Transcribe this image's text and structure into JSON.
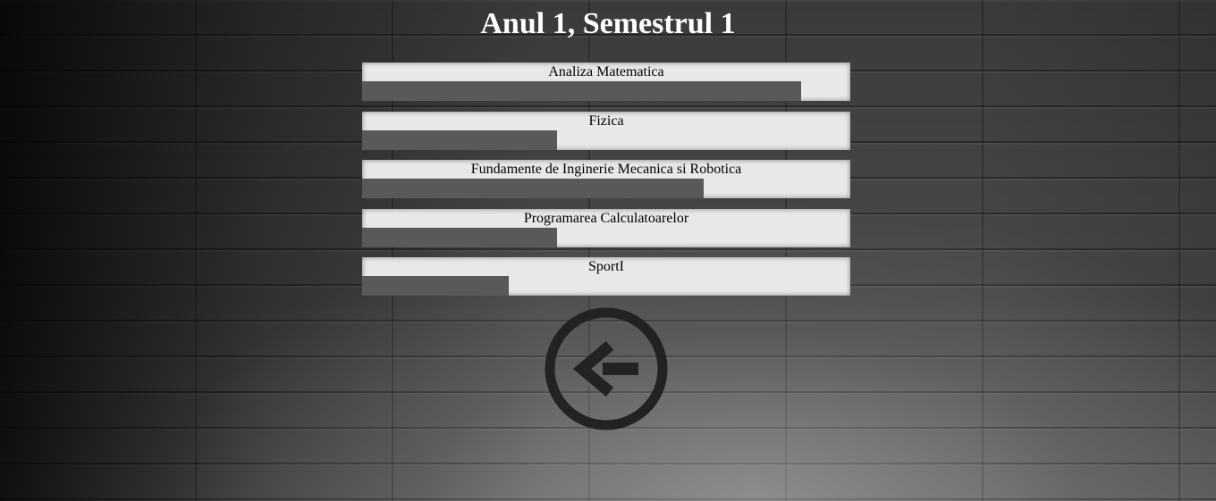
{
  "page": {
    "title": "Anul 1, Semestrul 1"
  },
  "courses": [
    {
      "name": "Analiza Matematica",
      "progress": 0.9
    },
    {
      "name": "Fizica",
      "progress": 0.4
    },
    {
      "name": "Fundamente de Inginerie Mecanica si Robotica",
      "progress": 0.7
    },
    {
      "name": "Programarea Calculatoarelor",
      "progress": 0.4
    },
    {
      "name": "SportI",
      "progress": 0.3
    }
  ],
  "back_button": {
    "icon": "arrow-left-circle-icon",
    "color": "#222222"
  },
  "colors": {
    "bar_fill": "#595959",
    "card_bg": "#e8e8e8",
    "title": "#ffffff"
  }
}
